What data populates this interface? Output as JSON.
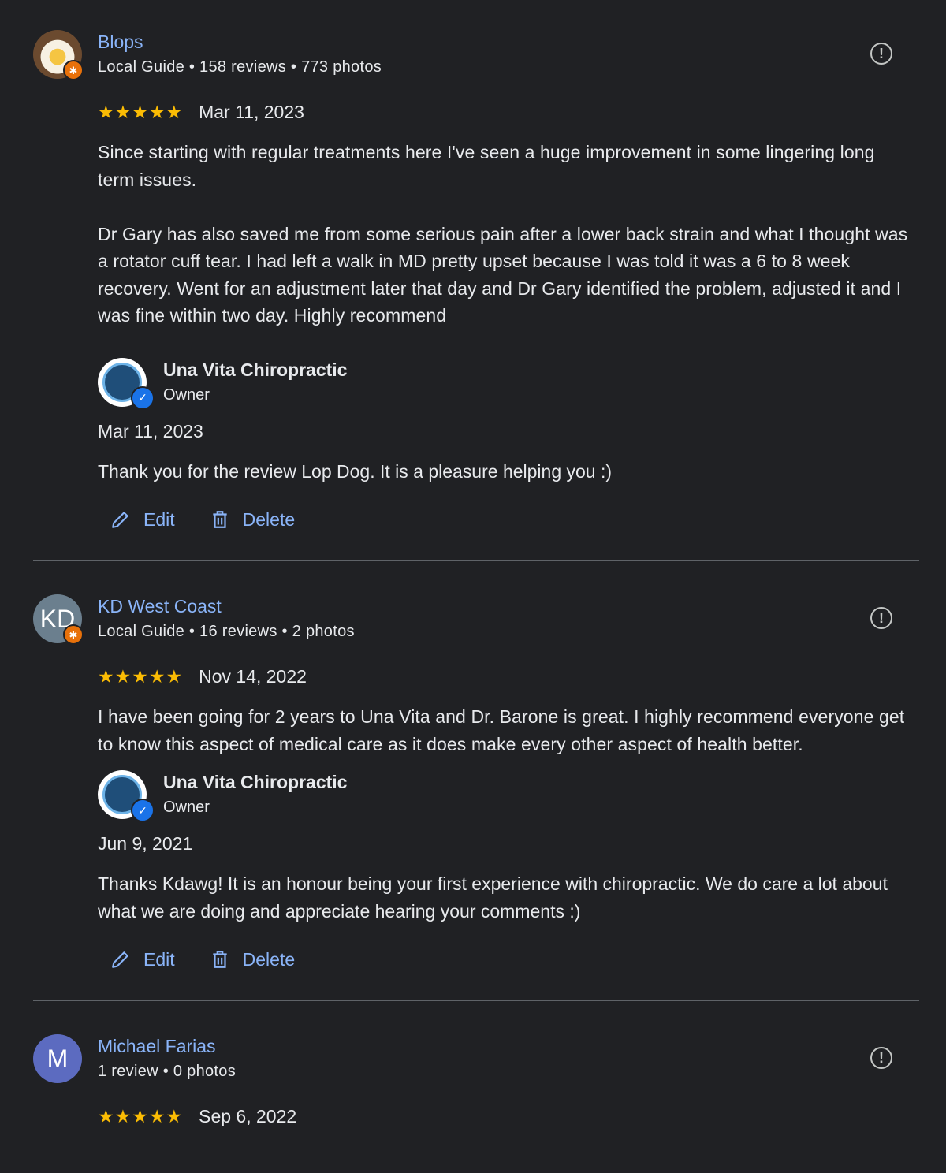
{
  "reviews": [
    {
      "name": "Blops",
      "meta": "Local Guide • 158 reviews • 773 photos",
      "avatar_letters": "",
      "stars": "★★★★★",
      "date": "Mar 11, 2023",
      "text": "Since starting with regular treatments here I've seen a huge improvement in some lingering long term issues.\n\nDr Gary has also saved me from some serious pain after a lower back strain and what I thought was a rotator cuff tear. I had left a walk in MD pretty upset because I was told it was a 6 to 8 week recovery. Went for an adjustment later that day and Dr Gary identified the problem, adjusted it and I was fine within two day. Highly recommend",
      "owner_name": "Una Vita Chiropractic",
      "owner_role": "Owner",
      "reply_date": "Mar 11, 2023",
      "reply_text": "Thank you for the review Lop Dog. It is a pleasure helping you :)",
      "edit_label": "Edit",
      "delete_label": "Delete"
    },
    {
      "name": "KD West Coast",
      "meta": "Local Guide • 16 reviews • 2 photos",
      "avatar_letters": "KD",
      "stars": "★★★★★",
      "date": "Nov 14, 2022",
      "text": "I have been going for 2 years to Una Vita and Dr. Barone is great. I highly recommend everyone get to know this aspect of medical care as it does make every other aspect of health better.",
      "owner_name": "Una Vita Chiropractic",
      "owner_role": "Owner",
      "reply_date": "Jun 9, 2021",
      "reply_text": "Thanks Kdawg! It is an honour being your first experience with chiropractic. We do care a lot about what we are doing and appreciate hearing your comments :)",
      "edit_label": "Edit",
      "delete_label": "Delete"
    },
    {
      "name": "Michael Farias",
      "meta": "1 review • 0 photos",
      "avatar_letters": "M",
      "stars": "★★★★★",
      "date": "Sep 6, 2022"
    }
  ],
  "colors": {
    "background": "#202124",
    "link": "#8ab4f8",
    "star": "#fbbc04",
    "local_guide_badge": "#e8710a",
    "verified": "#1a73e8"
  }
}
